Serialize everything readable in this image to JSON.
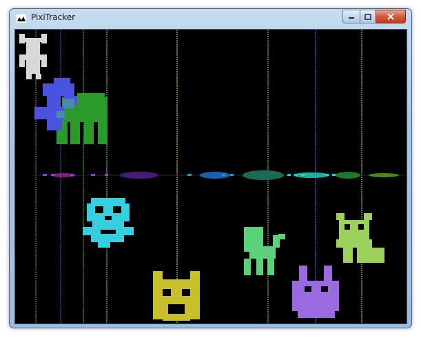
{
  "window": {
    "title": "PixiTracker"
  },
  "colors": {
    "background": "#000000"
  }
}
